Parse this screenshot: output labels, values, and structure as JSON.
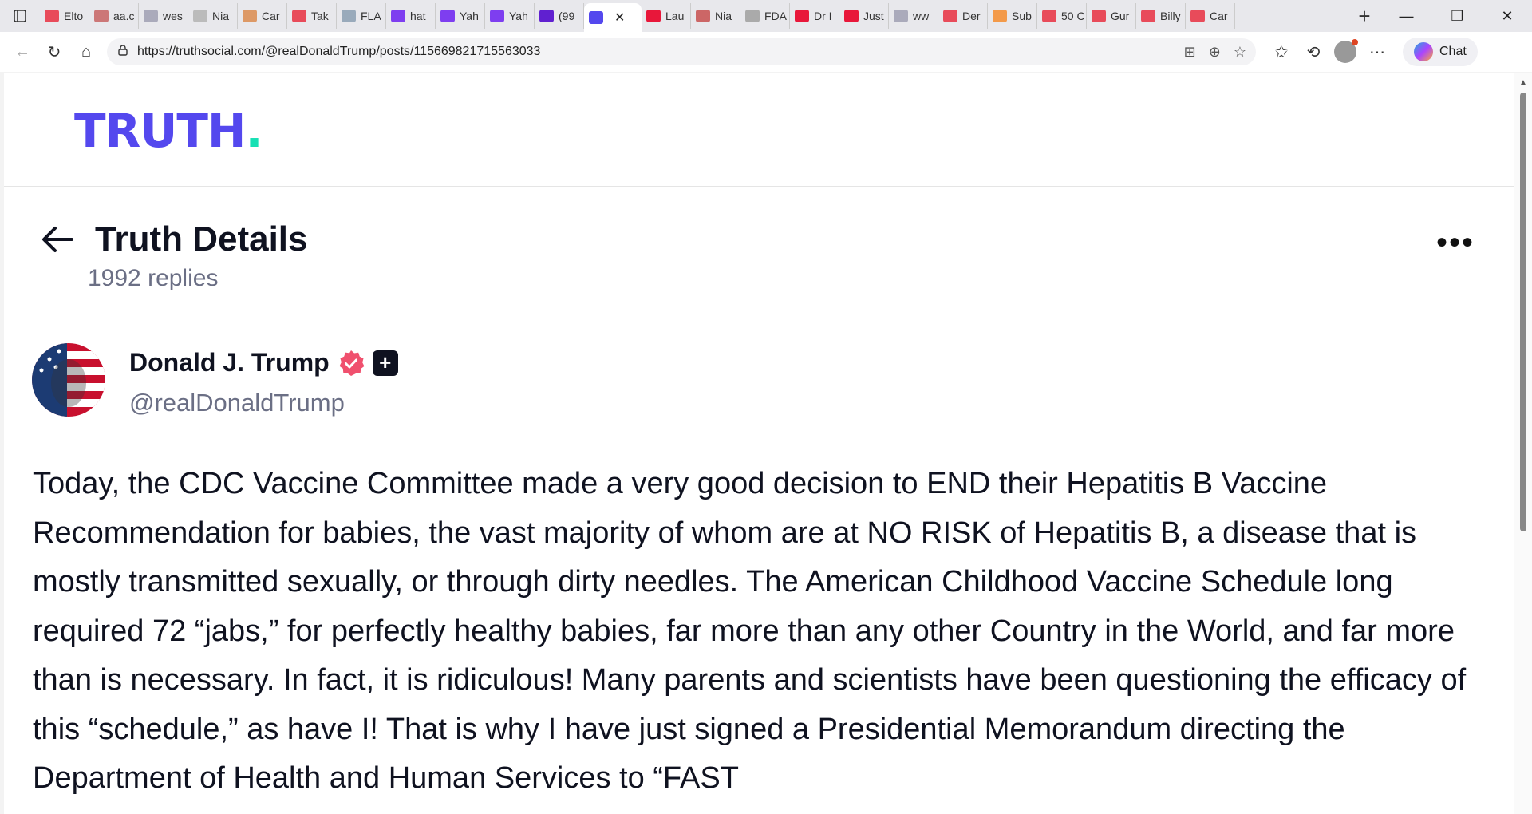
{
  "browser": {
    "tabs": [
      {
        "label": "Elto",
        "color": "#e84b5a"
      },
      {
        "label": "aa.c",
        "color": "#c77"
      },
      {
        "label": "wes",
        "color": "#aab"
      },
      {
        "label": "Nia",
        "color": "#bbb"
      },
      {
        "label": "Car",
        "color": "#d96"
      },
      {
        "label": "Tak",
        "color": "#e84b5a"
      },
      {
        "label": "FLA",
        "color": "#9ab"
      },
      {
        "label": "hat",
        "color": "#7e3ef0"
      },
      {
        "label": "Yah",
        "color": "#7e3ef0"
      },
      {
        "label": "Yah",
        "color": "#7e3ef0"
      },
      {
        "label": "(99",
        "color": "#6020d0"
      },
      {
        "label": "",
        "color": "#5448ee",
        "active": true
      },
      {
        "label": "Lau",
        "color": "#e8173a"
      },
      {
        "label": "Nia",
        "color": "#c66"
      },
      {
        "label": "FDA",
        "color": "#aaa"
      },
      {
        "label": "Dr I",
        "color": "#e8173a"
      },
      {
        "label": "Just",
        "color": "#e8173a"
      },
      {
        "label": "ww",
        "color": "#aab"
      },
      {
        "label": "Der",
        "color": "#e84b5a"
      },
      {
        "label": "Sub",
        "color": "#f39a4a"
      },
      {
        "label": "50 C",
        "color": "#e84b5a"
      },
      {
        "label": "Gur",
        "color": "#e84b5a"
      },
      {
        "label": "Billy",
        "color": "#e84b5a"
      },
      {
        "label": "Car",
        "color": "#e84b5a"
      }
    ],
    "url": "https://truthsocial.com/@realDonaldTrump/posts/115669821715563033",
    "chat_label": "Chat"
  },
  "site": {
    "logo_main": "TRUTH",
    "logo_dot": "."
  },
  "detail": {
    "title": "Truth Details",
    "replies": "1992 replies",
    "more": "•••"
  },
  "author": {
    "name": "Donald J. Trump",
    "handle": "@realDonaldTrump",
    "plus": "+"
  },
  "post": {
    "text": "Today, the CDC Vaccine Committee made a very good decision to END their Hepatitis B Vaccine Recommendation for babies, the vast majority of whom are at NO RISK of Hepatitis B, a disease that is mostly transmitted sexually, or through dirty needles. The American Childhood Vaccine Schedule long required 72 “jabs,” for perfectly healthy babies, far more than any other Country in the World, and far more than is necessary. In fact, it is ridiculous! Many parents and scientists have been questioning the efficacy of this “schedule,” as have I! That is why I have just signed a Presidential Memorandum directing the Department of Health and Human Services to “FAST"
  },
  "colors": {
    "brand": "#5448ee",
    "brand_accent": "#17e0b4",
    "verified": "#f0506e"
  }
}
